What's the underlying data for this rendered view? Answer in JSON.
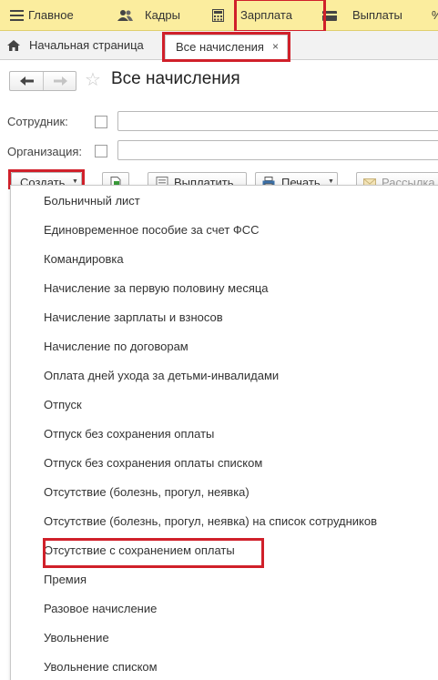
{
  "top_menu": {
    "items": [
      {
        "label": "Главное",
        "icon": "menu-lines-icon"
      },
      {
        "label": "Кадры",
        "icon": "people-icon"
      },
      {
        "label": "Зарплата",
        "icon": "calculator-icon"
      },
      {
        "label": "Выплаты",
        "icon": "wallet-icon"
      },
      {
        "label": "%",
        "icon": ""
      }
    ]
  },
  "tabs": {
    "home_label": "Начальная страница",
    "active_label": "Все начисления",
    "close_glyph": "×"
  },
  "page": {
    "title": "Все начисления"
  },
  "filters": {
    "employee_label": "Сотрудник:",
    "employee_value": "",
    "organization_label": "Организация:",
    "organization_value": ""
  },
  "toolbar": {
    "create_label": "Создать",
    "pay_label": "Выплатить",
    "print_label": "Печать",
    "mailing_label": "Рассылка"
  },
  "dropdown": {
    "items": [
      "Больничный лист",
      "Единовременное пособие за счет ФСС",
      "Командировка",
      "Начисление за первую половину месяца",
      "Начисление зарплаты и взносов",
      "Начисление по договорам",
      "Оплата дней ухода за детьми-инвалидами",
      "Отпуск",
      "Отпуск без сохранения оплаты",
      "Отпуск без сохранения оплаты списком",
      "Отсутствие (болезнь, прогул, неявка)",
      "Отсутствие (болезнь, прогул, неявка) на список сотрудников",
      "Отсутствие с сохранением оплаты",
      "Премия",
      "Разовое начисление",
      "Увольнение",
      "Увольнение списком"
    ],
    "highlighted_index": 12
  },
  "colors": {
    "top_bar": "#fbed9e",
    "highlight_border": "#d0202a"
  }
}
